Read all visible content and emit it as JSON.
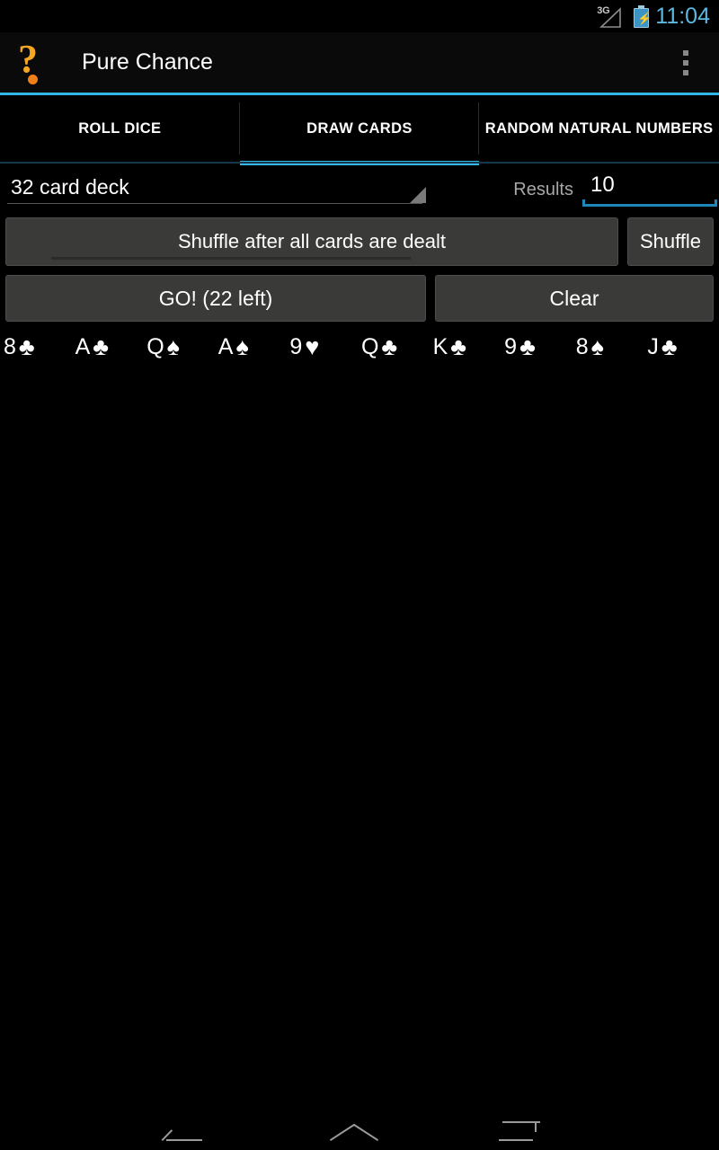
{
  "status_bar": {
    "network_type": "3G",
    "signal_icon": "signal-triangle-icon",
    "battery_icon": "battery-charging-icon",
    "clock": "11:04",
    "clock_color": "#5bb8e0"
  },
  "action_bar": {
    "app_icon": "question-mark-icon",
    "app_icon_color": "#f5a623",
    "title": "Pure Chance",
    "overflow_icon": "overflow-menu-icon",
    "accent_color": "#33b5e5"
  },
  "tabs": [
    {
      "label": "ROLL DICE",
      "active": false
    },
    {
      "label": "DRAW CARDS",
      "active": true
    },
    {
      "label": "RANDOM NATURAL NUMBERS",
      "active": false
    }
  ],
  "controls": {
    "deck_spinner": {
      "value": "32 card deck",
      "arrow_icon": "spinner-arrow-icon"
    },
    "results": {
      "label": "Results",
      "value": "10",
      "placeholder": "10",
      "focus_color": "#1c87b8"
    },
    "shuffle_toggle_label": "Shuffle after all cards are dealt",
    "shuffle_button_label": "Shuffle",
    "go_button_label": "GO! (22 left)",
    "clear_button_label": "Clear"
  },
  "cards": [
    {
      "rank": "8",
      "suit": "♣",
      "suit_name": "clubs"
    },
    {
      "rank": "A",
      "suit": "♣",
      "suit_name": "clubs"
    },
    {
      "rank": "Q",
      "suit": "♠",
      "suit_name": "spades"
    },
    {
      "rank": "A",
      "suit": "♠",
      "suit_name": "spades"
    },
    {
      "rank": "9",
      "suit": "♥",
      "suit_name": "hearts"
    },
    {
      "rank": "Q",
      "suit": "♣",
      "suit_name": "clubs"
    },
    {
      "rank": "K",
      "suit": "♣",
      "suit_name": "clubs"
    },
    {
      "rank": "9",
      "suit": "♣",
      "suit_name": "clubs"
    },
    {
      "rank": "8",
      "suit": "♠",
      "suit_name": "spades"
    },
    {
      "rank": "J",
      "suit": "♣",
      "suit_name": "clubs"
    }
  ],
  "nav_bar": {
    "back_icon": "back-arrow-icon",
    "home_icon": "home-chevron-icon",
    "recents_icon": "recent-apps-icon"
  }
}
